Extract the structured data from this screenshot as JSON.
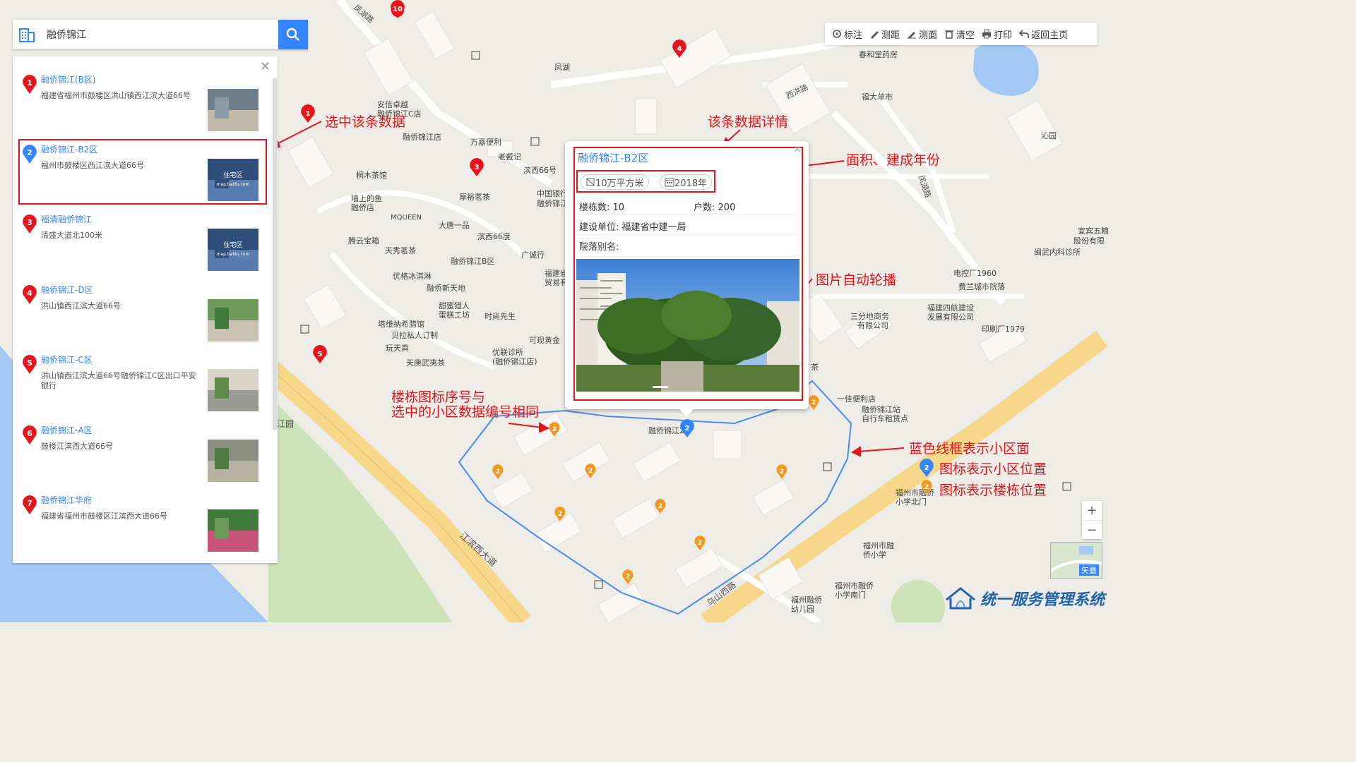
{
  "search": {
    "value": "融侨锦江"
  },
  "results": [
    {
      "num": "1",
      "name": "融侨锦江(B区)",
      "addr": "福建省福州市鼓楼区洪山镇西江滨大道66号",
      "color": "#e8141b"
    },
    {
      "num": "2",
      "name": "融侨锦江-B2区",
      "addr": "福州市鼓楼区西江滨大道66号",
      "color": "#3385ff"
    },
    {
      "num": "3",
      "name": "福清融侨锦江",
      "addr": "清盛大道北100米",
      "color": "#e8141b"
    },
    {
      "num": "4",
      "name": "融侨锦江-D区",
      "addr": "洪山镇西江滨大道66号",
      "color": "#e8141b"
    },
    {
      "num": "5",
      "name": "融侨锦江-C区",
      "addr": "洪山镇西江滨大道66号融侨锦江C区出口平安银行",
      "color": "#e8141b"
    },
    {
      "num": "6",
      "name": "融侨锦江-A区",
      "addr": "鼓楼江滨西大道66号",
      "color": "#e8141b"
    },
    {
      "num": "7",
      "name": "融侨锦江华府",
      "addr": "福建省福州市鼓楼区江滨西大道66号",
      "color": "#e8141b"
    }
  ],
  "thumb_text": {
    "line1": "住宅区",
    "line2": "map.baidu.com"
  },
  "toolbar": [
    "标注",
    "测距",
    "测面",
    "清空",
    "打印",
    "返回主页"
  ],
  "popup": {
    "title": "融侨锦江-B2区",
    "area": "10万平方米",
    "year": "2018年",
    "buildings_label": "楼栋数:",
    "buildings": "10",
    "households_label": "户数:",
    "households": "200",
    "builder_label": "建设单位:",
    "builder": "福建省中建一局",
    "alias_label": "院落别名:",
    "alias": ""
  },
  "annotations": {
    "select": "选中该条数据",
    "detail": "该条数据详情",
    "area_year": "面积、建成年份",
    "carousel": "图片自动轮播",
    "num_line1": "楼栋图标序号与",
    "num_line2": "选中的小区数据编号相同",
    "boundary": "蓝色线框表示小区面",
    "community_icon": "图标表示小区位置",
    "building_icon": "图标表示楼栋位置"
  },
  "map_labels": [
    "安信卓越",
    "融侨锦江C店",
    "融侨锦江店",
    "万嘉便利",
    "老戴记",
    "滨西66号",
    "桐木茶馆",
    "墙上的鱼",
    "融侨店",
    "厚裕茗茶",
    "中国银行",
    "融侨锦江",
    "MQUEEN",
    "大唐一品",
    "滨西66度",
    "腾云宝箱",
    "天秀茗茶",
    "融侨锦江B区",
    "广诚行",
    "优格冰淇淋",
    "融侨新天地",
    "福建省",
    "贸易有",
    "甜蜜猎人",
    "蛋糕工坊",
    "时尚先生",
    "塔维纳希腊馆",
    "贝拉私人订制",
    "可现黄金",
    "玩天真",
    "优联诊所",
    "(融侨锦江店)",
    "天庚武夷茶",
    "凤湖",
    "春和堂药房",
    "福大单市",
    "沁园",
    "宜宾五粮",
    "股份有限",
    "闽武内科诊所",
    "电控厂1960",
    "费兰城市院落",
    "三分地商务",
    "有限公司",
    "福建四航建设",
    "发展有限公司",
    "印刷厂1979",
    "一佳便利店",
    "融侨锦江站",
    "自行车租赁点",
    "融侨锦江2",
    "福州市融侨",
    "小学北门",
    "福州市融",
    "侨小学",
    "福州市融侨",
    "小学南门",
    "福州融侨",
    "幼儿园",
    "江滨西大道",
    "乌山西路",
    "江园",
    "茶",
    "凤湖路",
    "凤湖路",
    "西洪路"
  ],
  "zoom": {
    "in": "+",
    "out": "−"
  },
  "sat_label": "矢量",
  "brand": "统一服务管理系统"
}
